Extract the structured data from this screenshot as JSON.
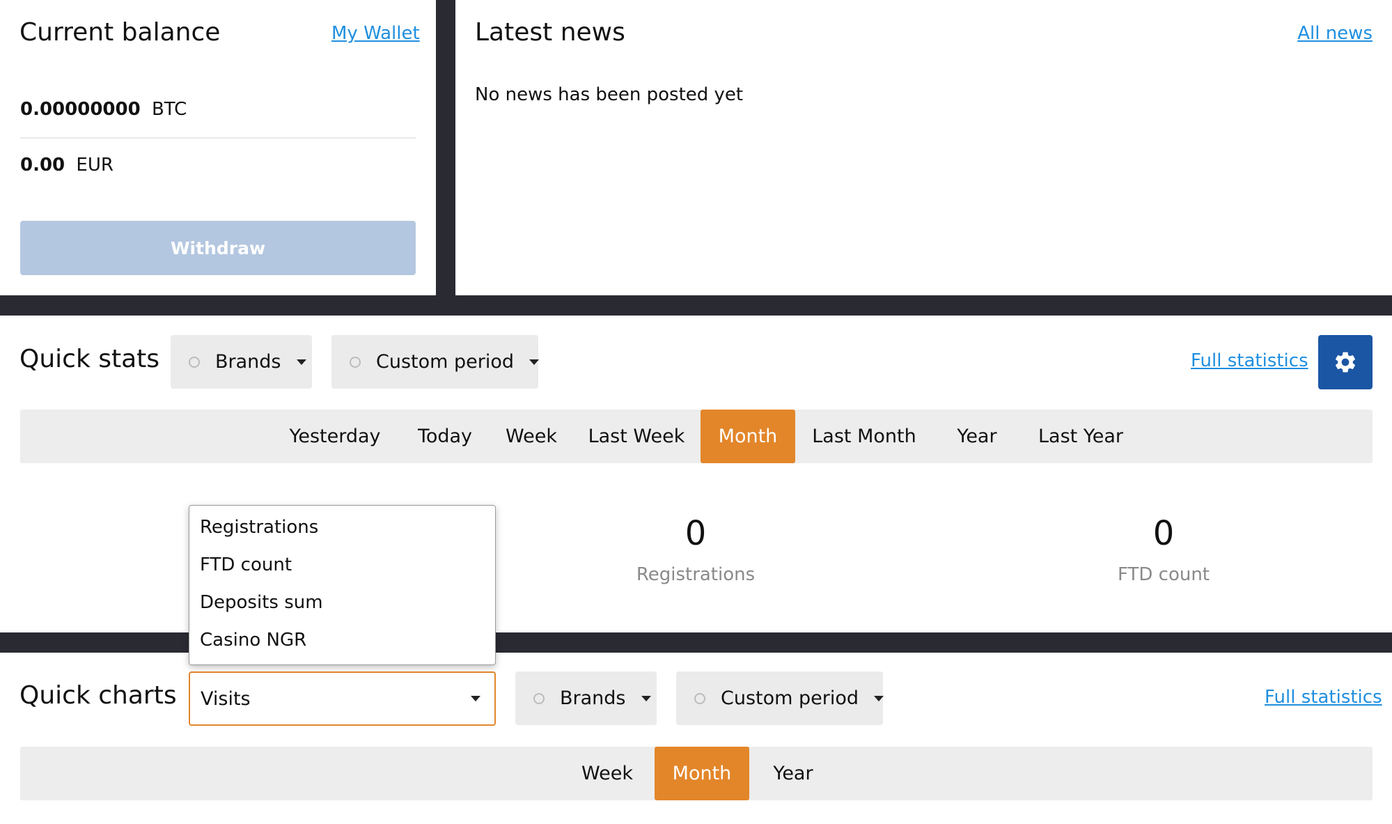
{
  "balance": {
    "title": "Current balance",
    "wallet_link": "My Wallet",
    "btc_amount": "0.00000000",
    "btc_currency": "BTC",
    "eur_amount": "0.00",
    "eur_currency": "EUR",
    "withdraw_label": "Withdraw"
  },
  "news": {
    "title": "Latest news",
    "all_link": "All news",
    "empty_message": "No news has been posted yet"
  },
  "quick_stats": {
    "title": "Quick stats",
    "brands_label": "Brands",
    "period_label": "Custom period",
    "full_stats_link": "Full statistics",
    "settings_icon": "gear-icon",
    "periods": [
      "Yesterday",
      "Today",
      "Week",
      "Last Week",
      "Month",
      "Last Month",
      "Year",
      "Last Year"
    ],
    "active_period": "Month",
    "stats": [
      {
        "value": "0",
        "label": "Registrations"
      },
      {
        "value": "0",
        "label": "FTD count"
      }
    ]
  },
  "metric_menu": {
    "options": [
      "Registrations",
      "FTD count",
      "Deposits sum",
      "Casino NGR"
    ]
  },
  "quick_charts": {
    "title": "Quick charts",
    "metric_selected": "Visits",
    "brands_label": "Brands",
    "period_label": "Custom period",
    "full_stats_link": "Full statistics",
    "periods": [
      "Week",
      "Month",
      "Year"
    ],
    "active_period": "Month"
  },
  "colors": {
    "accent_orange": "#e3862a",
    "link_blue": "#1f8fe0",
    "settings_blue": "#1b56a4",
    "withdraw_disabled": "#b4c7e0",
    "background_dark": "#2a2a33"
  }
}
